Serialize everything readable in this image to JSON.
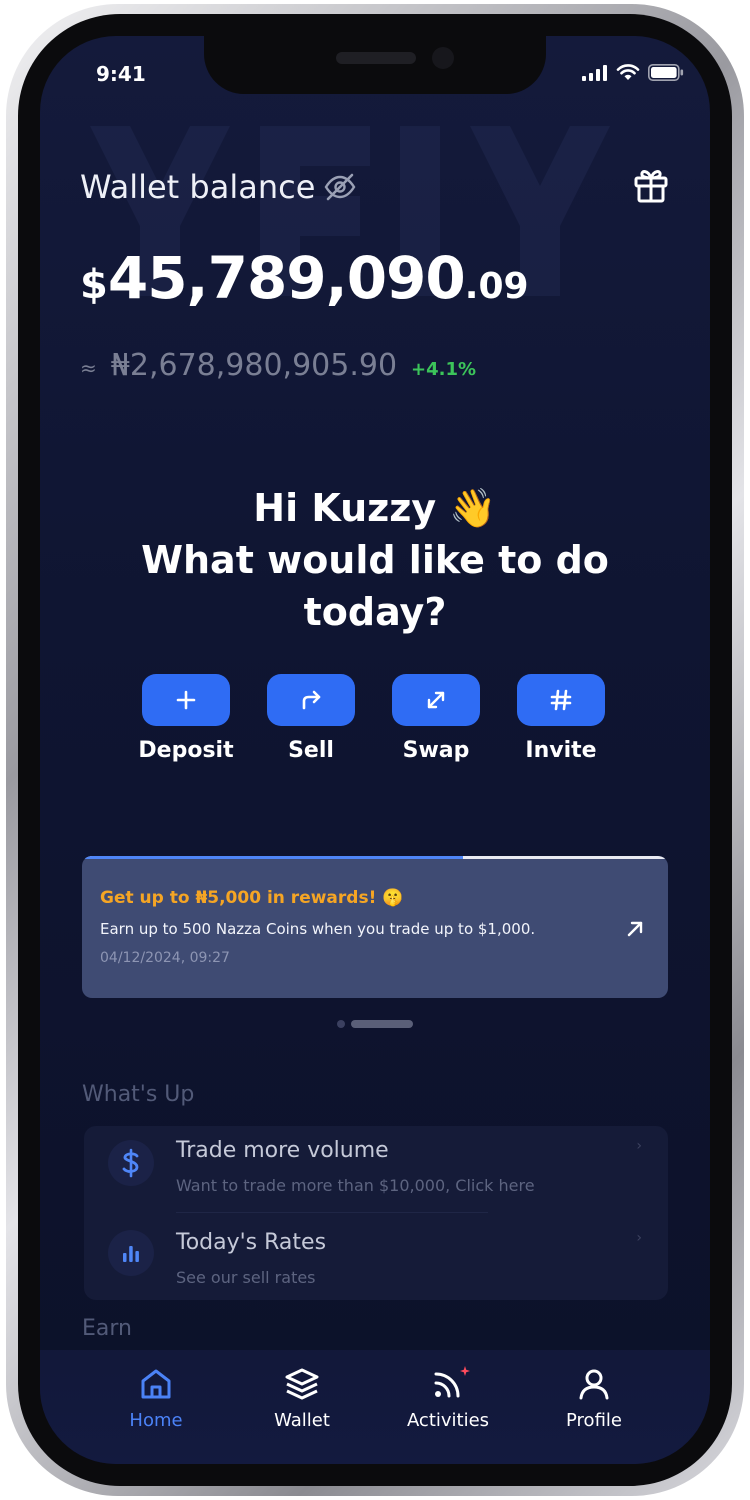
{
  "status_bar": {
    "time": "9:41"
  },
  "wallet": {
    "label": "Wallet balance",
    "balance_currency": "$",
    "balance_main": "45,789,090",
    "balance_decimal": ".09",
    "approx_symbol": "≈",
    "ngn_value": "₦2,678,980,905.90",
    "change": "+4.1%"
  },
  "greeting": {
    "line1": "Hi Kuzzy 👋",
    "line2": "What would like to do",
    "line3": "today?"
  },
  "actions": [
    {
      "label": "Deposit",
      "icon": "plus-icon"
    },
    {
      "label": "Sell",
      "icon": "share-arrow-icon"
    },
    {
      "label": "Swap",
      "icon": "expand-arrows-icon"
    },
    {
      "label": "Invite",
      "icon": "hash-icon"
    }
  ],
  "promo": {
    "title": "Get up to ₦5,000 in rewards! 🤫",
    "text": "Earn up to 500 Nazza Coins when you trade up to $1,000.",
    "date": "04/12/2024, 09:27",
    "progress": 0.65
  },
  "whats_up": {
    "title": "What's Up",
    "items": [
      {
        "title": "Trade more volume",
        "subtitle": "Want to trade more than $10,000, Click here",
        "icon": "dollar-icon"
      },
      {
        "title": "Today's Rates",
        "subtitle": "See our sell rates",
        "icon": "bar-chart-icon"
      }
    ]
  },
  "earn": {
    "title": "Earn"
  },
  "tabs": [
    {
      "label": "Home",
      "icon": "home-icon",
      "active": true
    },
    {
      "label": "Wallet",
      "icon": "layers-icon",
      "active": false
    },
    {
      "label": "Activities",
      "icon": "rss-icon",
      "active": false
    },
    {
      "label": "Profile",
      "icon": "user-icon",
      "active": false
    }
  ],
  "colors": {
    "accent": "#2f6cf4",
    "positive": "#3cc45a",
    "promo_title": "#f5a524",
    "screen_bg": "#0e1430"
  }
}
